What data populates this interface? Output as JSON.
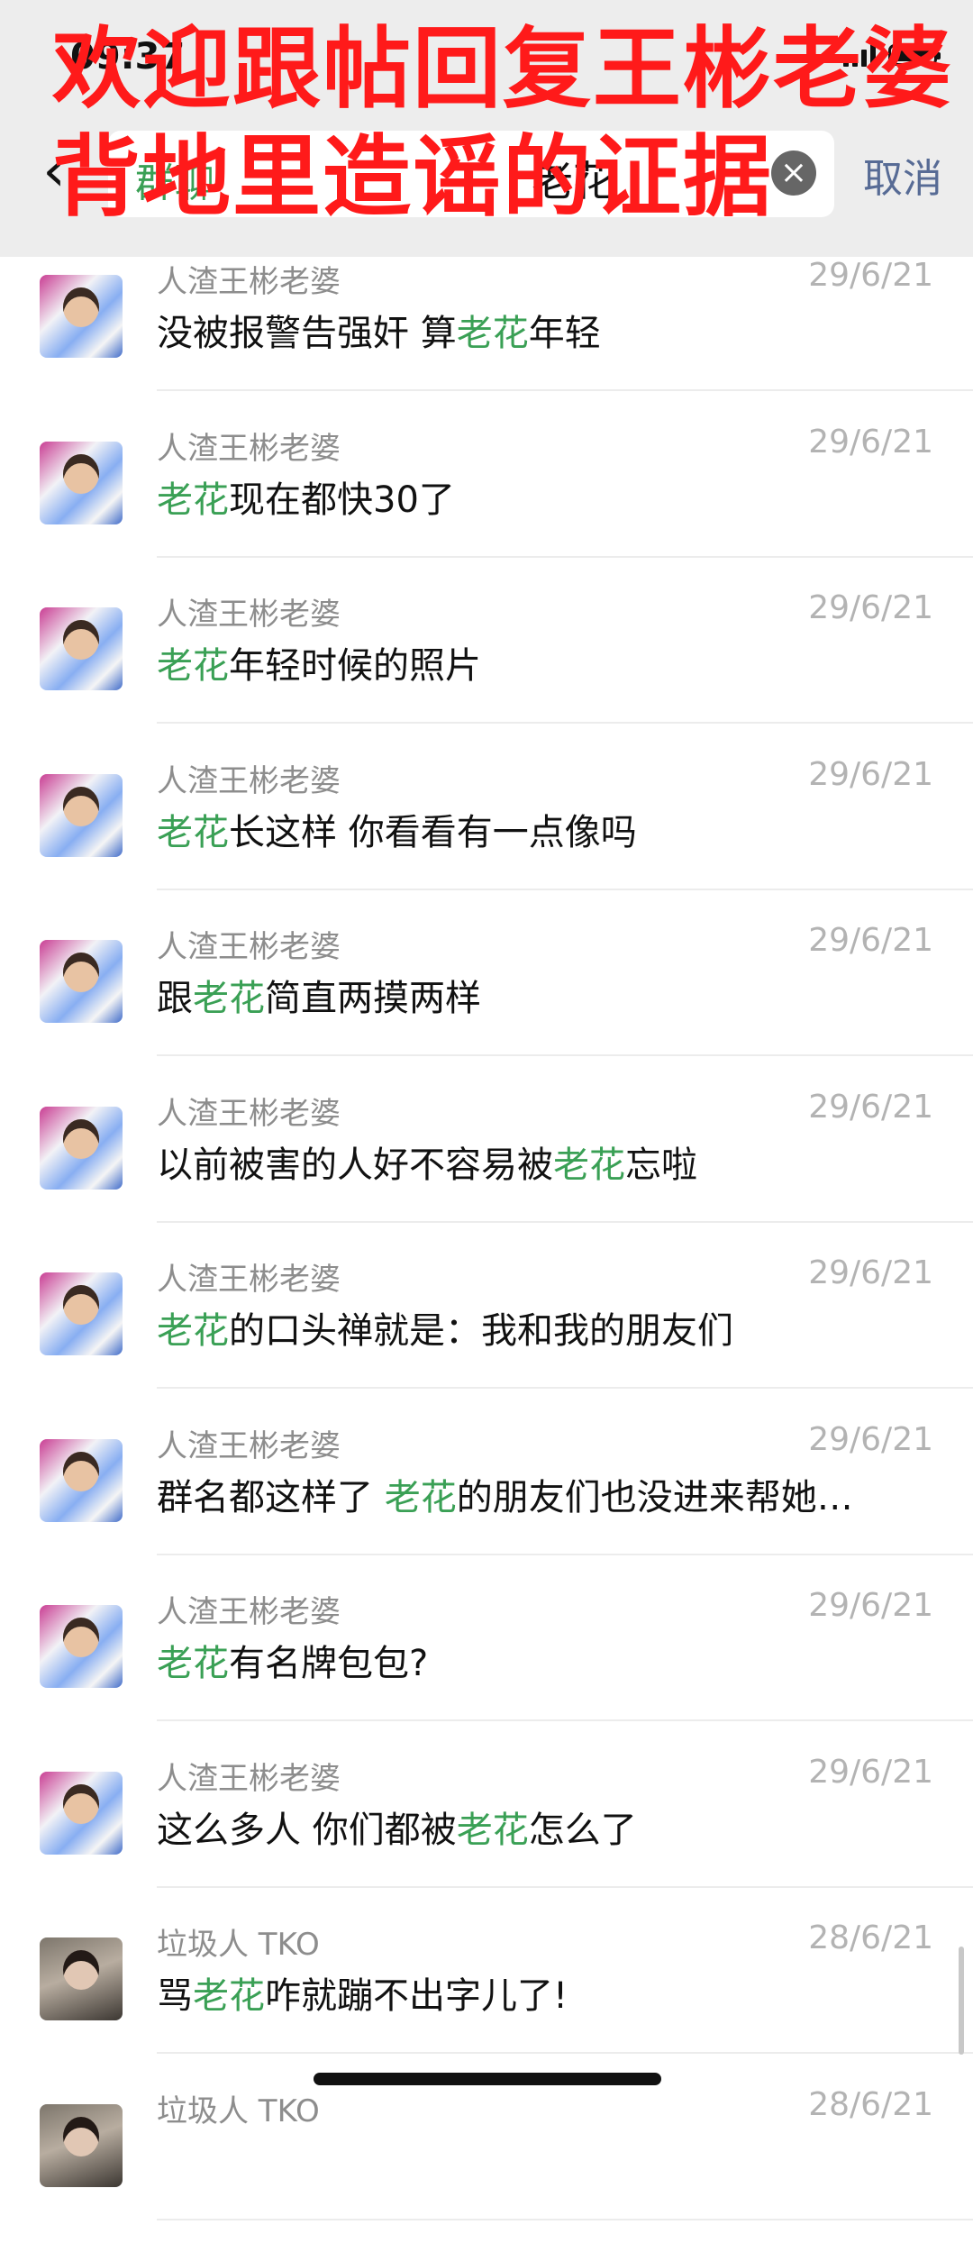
{
  "status_bar": {
    "time": "09:37"
  },
  "overlay": {
    "line1": "欢迎跟帖回复王彬老婆",
    "line2": "背地里造谣的证据"
  },
  "search": {
    "tag": "群聊",
    "query": "老花",
    "clear_icon": "×",
    "cancel_label": "取消",
    "back_icon": "‹"
  },
  "keyword": "老花",
  "messages": [
    {
      "name": "人渣王彬老婆",
      "date": "29/6/21",
      "before": "没被报警告强奸 算",
      "kw": "老花",
      "after": "年轻",
      "avatar": "girl"
    },
    {
      "name": "人渣王彬老婆",
      "date": "29/6/21",
      "before": "",
      "kw": "老花",
      "after": "现在都快30了",
      "avatar": "girl"
    },
    {
      "name": "人渣王彬老婆",
      "date": "29/6/21",
      "before": "",
      "kw": "老花",
      "after": "年轻时候的照片",
      "avatar": "girl"
    },
    {
      "name": "人渣王彬老婆",
      "date": "29/6/21",
      "before": "",
      "kw": "老花",
      "after": "长这样 你看看有一点像吗",
      "avatar": "girl"
    },
    {
      "name": "人渣王彬老婆",
      "date": "29/6/21",
      "before": "跟",
      "kw": "老花",
      "after": "简直两摸两样",
      "avatar": "girl"
    },
    {
      "name": "人渣王彬老婆",
      "date": "29/6/21",
      "before": "以前被害的人好不容易被",
      "kw": "老花",
      "after": "忘啦",
      "avatar": "girl"
    },
    {
      "name": "人渣王彬老婆",
      "date": "29/6/21",
      "before": "",
      "kw": "老花",
      "after": "的口头禅就是：我和我的朋友们",
      "avatar": "girl"
    },
    {
      "name": "人渣王彬老婆",
      "date": "29/6/21",
      "before": "群名都这样了 ",
      "kw": "老花",
      "after": "的朋友们也没进来帮她…",
      "avatar": "girl"
    },
    {
      "name": "人渣王彬老婆",
      "date": "29/6/21",
      "before": "",
      "kw": "老花",
      "after": "有名牌包包?",
      "avatar": "girl"
    },
    {
      "name": "人渣王彬老婆",
      "date": "29/6/21",
      "before": "这么多人 你们都被",
      "kw": "老花",
      "after": "怎么了",
      "avatar": "girl"
    },
    {
      "name": "垃圾人 TKO",
      "date": "28/6/21",
      "before": "骂",
      "kw": "老花",
      "after": "咋就蹦不出字儿了!",
      "avatar": "man"
    },
    {
      "name": "垃圾人 TKO",
      "date": "28/6/21",
      "before": "",
      "kw": "",
      "after": "",
      "avatar": "man"
    }
  ]
}
